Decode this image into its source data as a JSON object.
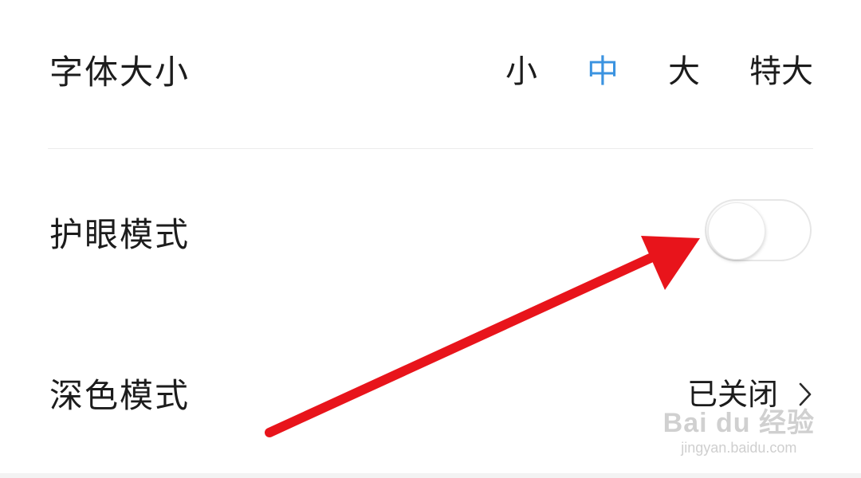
{
  "font_size": {
    "label": "字体大小",
    "options": [
      "小",
      "中",
      "大",
      "特大"
    ],
    "selected": "中",
    "accent_color": "#3b93e0"
  },
  "eye_care_mode": {
    "label": "护眼模式",
    "toggle_on": false
  },
  "dark_mode": {
    "label": "深色模式",
    "value": "已关闭",
    "chevron_icon": "chevron-right-icon"
  },
  "annotation": {
    "type": "arrow",
    "color": "#e8141b"
  },
  "watermark": {
    "main": "Bai du 经验",
    "sub": "jingyan.baidu.com"
  }
}
